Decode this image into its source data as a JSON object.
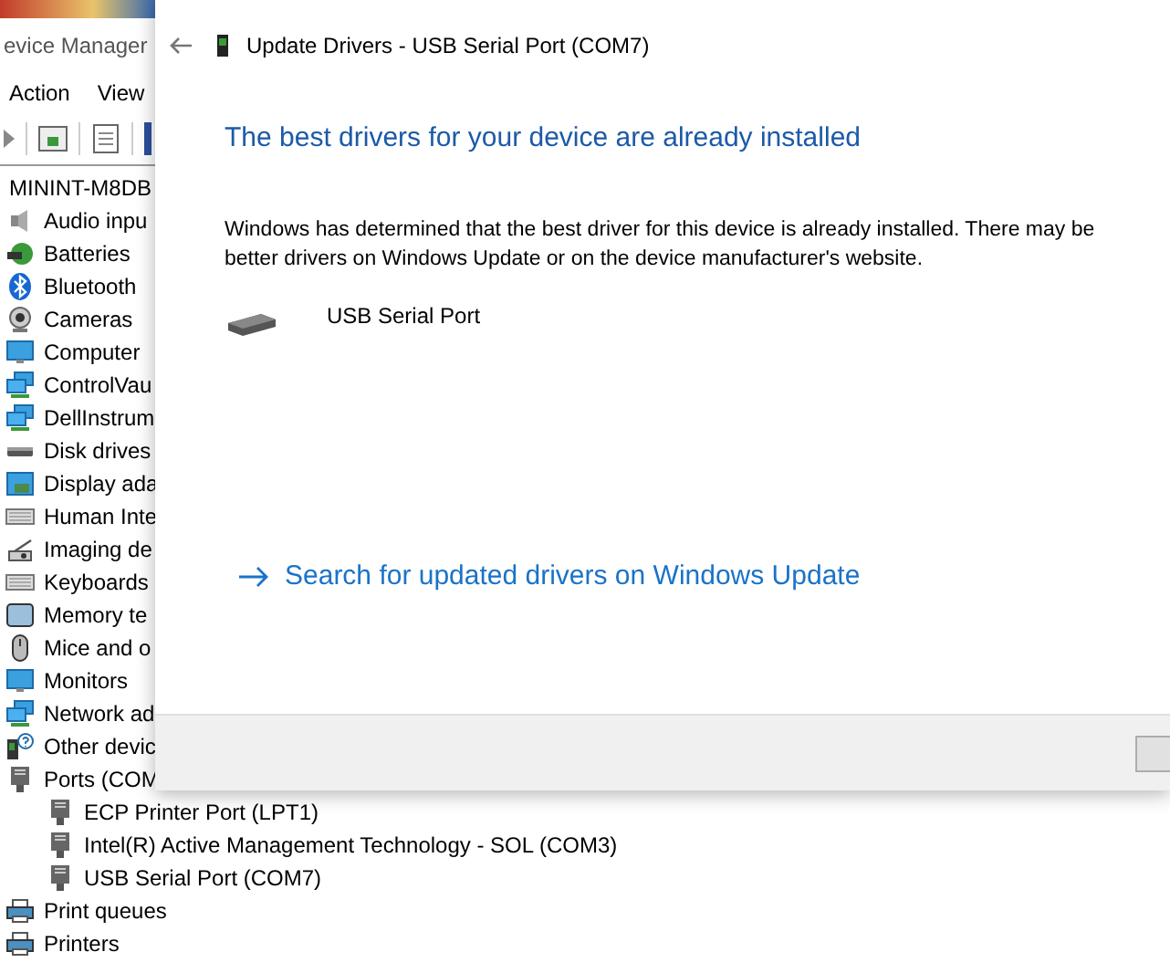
{
  "background_window": {
    "title": "evice Manager",
    "menu": [
      "Action",
      "View"
    ],
    "tree": {
      "label": "MININT-M8DB",
      "children": [
        {
          "label": "Audio inpu",
          "kind": "speaker"
        },
        {
          "label": "Batteries",
          "kind": "battery"
        },
        {
          "label": "Bluetooth",
          "kind": "bluetooth"
        },
        {
          "label": "Cameras",
          "kind": "camera"
        },
        {
          "label": "Computer",
          "kind": "monitor"
        },
        {
          "label": "ControlVau",
          "kind": "network"
        },
        {
          "label": "DellInstrum",
          "kind": "network"
        },
        {
          "label": "Disk drives",
          "kind": "disk"
        },
        {
          "label": "Display ada",
          "kind": "display"
        },
        {
          "label": "Human Inte",
          "kind": "keyboard"
        },
        {
          "label": "Imaging de",
          "kind": "scanner"
        },
        {
          "label": "Keyboards",
          "kind": "keyboard"
        },
        {
          "label": "Memory te",
          "kind": "memory"
        },
        {
          "label": "Mice and o",
          "kind": "mouse"
        },
        {
          "label": "Monitors",
          "kind": "monitor"
        },
        {
          "label": "Network ad",
          "kind": "network"
        },
        {
          "label": "Other devic",
          "kind": "unknown"
        },
        {
          "label": "Ports (COM",
          "kind": "port",
          "children": [
            {
              "label": "ECP Printer Port (LPT1)",
              "kind": "port"
            },
            {
              "label": "Intel(R) Active Management Technology - SOL (COM3)",
              "kind": "port"
            },
            {
              "label": "USB Serial Port (COM7)",
              "kind": "port"
            }
          ]
        },
        {
          "label": "Print queues",
          "kind": "printer"
        },
        {
          "label": "Printers",
          "kind": "printer"
        }
      ]
    }
  },
  "dialog": {
    "title": "Update Drivers - USB Serial Port (COM7)",
    "heading": "The best drivers for your device are already installed",
    "message": "Windows has determined that the best driver for this device is already installed. There may be better drivers on Windows Update or on the device manufacturer's website.",
    "device_name": "USB Serial Port",
    "link": "Search for updated drivers on Windows Update"
  }
}
